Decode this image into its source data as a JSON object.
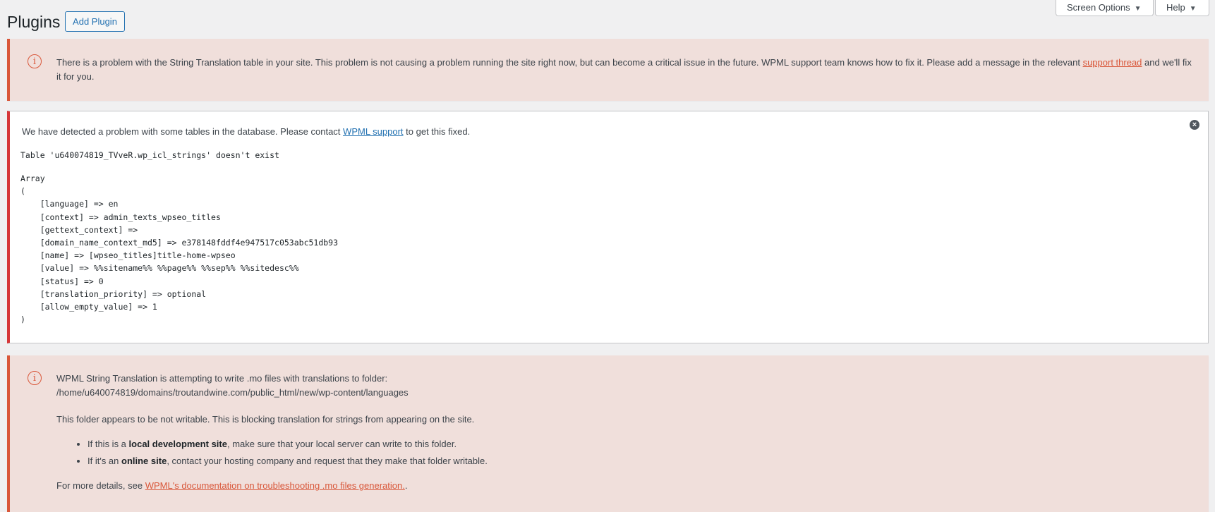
{
  "screen_meta": {
    "screen_options_label": "Screen Options",
    "help_label": "Help"
  },
  "header": {
    "title": "Plugins",
    "add_plugin_label": "Add Plugin"
  },
  "notice_string_table": {
    "text_before": "There is a problem with the String Translation table in your site. This problem is not causing a problem running the site right now, but can become a critical issue in the future. WPML support team knows how to fix it. Please add a message in the relevant ",
    "link_text": "support thread",
    "text_after": " and we'll fix it for you."
  },
  "notice_db_tables": {
    "intro_before": "We have detected a problem with some tables in the database. Please contact ",
    "link_text": "WPML support",
    "intro_after": " to get this fixed.",
    "error_line": "Table 'u640074819_TVveR.wp_icl_strings' doesn't exist",
    "dump": "Array\n(\n    [language] => en\n    [context] => admin_texts_wpseo_titles\n    [gettext_context] => \n    [domain_name_context_md5] => e378148fddf4e947517c053abc51db93\n    [name] => [wpseo_titles]title-home-wpseo\n    [value] => %%sitename%% %%page%% %%sep%% %%sitedesc%%\n    [status] => 0\n    [translation_priority] => optional\n    [allow_empty_value] => 1\n)"
  },
  "notice_mo_files": {
    "line1": "WPML String Translation is attempting to write .mo files with translations to folder:",
    "line2": "/home/u640074819/domains/troutandwine.com/public_html/new/wp-content/languages",
    "line3": "This folder appears to be not writable. This is blocking translation for strings from appearing on the site.",
    "bullets": [
      {
        "before": "If this is a ",
        "bold": "local development site",
        "after": ", make sure that your local server can write to this folder."
      },
      {
        "before": "If it's an ",
        "bold": "online site",
        "after": ", contact your hosting company and request that they make that folder writable."
      }
    ],
    "details_before": "For more details, see ",
    "details_link": "WPML's documentation on troubleshooting .mo files generation.",
    "details_after": "."
  },
  "colors": {
    "warning_border": "#d9573a",
    "warning_bg": "#f0dfdb",
    "error_border": "#d63638",
    "link_blue": "#2271b1"
  },
  "icons": {
    "info": "info-circle-icon",
    "close": "close-circle-icon",
    "dropdown": "caret-down-icon"
  }
}
